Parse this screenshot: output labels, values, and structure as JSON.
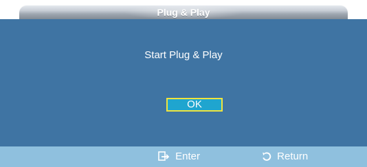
{
  "dialog": {
    "title": "Plug & Play",
    "message": "Start Plug & Play",
    "ok_label": "OK"
  },
  "footer": {
    "enter_label": "Enter",
    "return_label": "Return",
    "enter_icon": "enter-icon",
    "return_icon": "return-icon"
  },
  "colors": {
    "panel_background": "#3f74a3",
    "footer_background": "#8fc0de",
    "ok_button_fill": "#1fa5cf",
    "ok_button_border": "#f2e43c",
    "title_bar_start": "#e9edf2",
    "title_bar_end": "#7d8690"
  }
}
